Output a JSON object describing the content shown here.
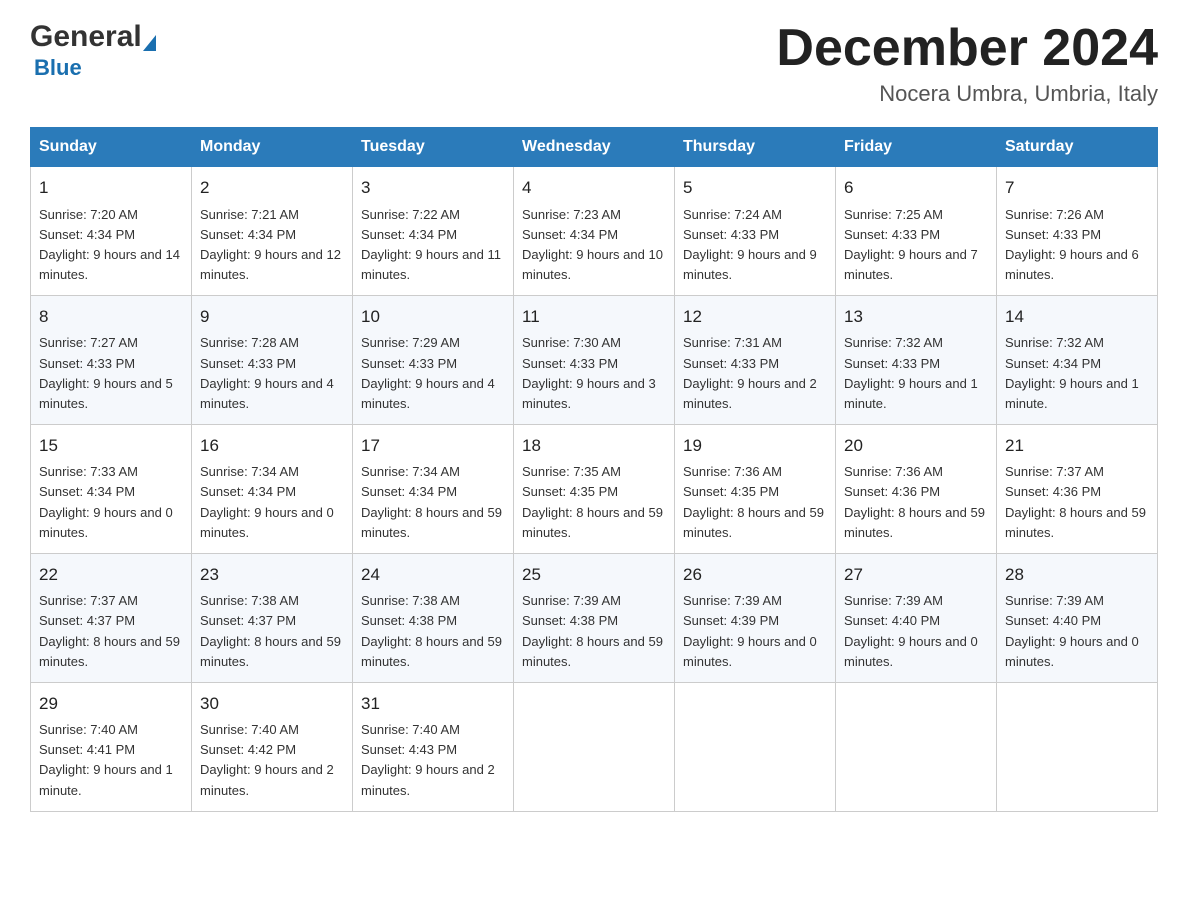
{
  "header": {
    "logo_general": "General",
    "logo_blue": "Blue",
    "month_title": "December 2024",
    "location": "Nocera Umbra, Umbria, Italy"
  },
  "days_of_week": [
    "Sunday",
    "Monday",
    "Tuesday",
    "Wednesday",
    "Thursday",
    "Friday",
    "Saturday"
  ],
  "weeks": [
    [
      {
        "day": 1,
        "sunrise": "7:20 AM",
        "sunset": "4:34 PM",
        "daylight": "9 hours and 14 minutes."
      },
      {
        "day": 2,
        "sunrise": "7:21 AM",
        "sunset": "4:34 PM",
        "daylight": "9 hours and 12 minutes."
      },
      {
        "day": 3,
        "sunrise": "7:22 AM",
        "sunset": "4:34 PM",
        "daylight": "9 hours and 11 minutes."
      },
      {
        "day": 4,
        "sunrise": "7:23 AM",
        "sunset": "4:34 PM",
        "daylight": "9 hours and 10 minutes."
      },
      {
        "day": 5,
        "sunrise": "7:24 AM",
        "sunset": "4:33 PM",
        "daylight": "9 hours and 9 minutes."
      },
      {
        "day": 6,
        "sunrise": "7:25 AM",
        "sunset": "4:33 PM",
        "daylight": "9 hours and 7 minutes."
      },
      {
        "day": 7,
        "sunrise": "7:26 AM",
        "sunset": "4:33 PM",
        "daylight": "9 hours and 6 minutes."
      }
    ],
    [
      {
        "day": 8,
        "sunrise": "7:27 AM",
        "sunset": "4:33 PM",
        "daylight": "9 hours and 5 minutes."
      },
      {
        "day": 9,
        "sunrise": "7:28 AM",
        "sunset": "4:33 PM",
        "daylight": "9 hours and 4 minutes."
      },
      {
        "day": 10,
        "sunrise": "7:29 AM",
        "sunset": "4:33 PM",
        "daylight": "9 hours and 4 minutes."
      },
      {
        "day": 11,
        "sunrise": "7:30 AM",
        "sunset": "4:33 PM",
        "daylight": "9 hours and 3 minutes."
      },
      {
        "day": 12,
        "sunrise": "7:31 AM",
        "sunset": "4:33 PM",
        "daylight": "9 hours and 2 minutes."
      },
      {
        "day": 13,
        "sunrise": "7:32 AM",
        "sunset": "4:33 PM",
        "daylight": "9 hours and 1 minute."
      },
      {
        "day": 14,
        "sunrise": "7:32 AM",
        "sunset": "4:34 PM",
        "daylight": "9 hours and 1 minute."
      }
    ],
    [
      {
        "day": 15,
        "sunrise": "7:33 AM",
        "sunset": "4:34 PM",
        "daylight": "9 hours and 0 minutes."
      },
      {
        "day": 16,
        "sunrise": "7:34 AM",
        "sunset": "4:34 PM",
        "daylight": "9 hours and 0 minutes."
      },
      {
        "day": 17,
        "sunrise": "7:34 AM",
        "sunset": "4:34 PM",
        "daylight": "8 hours and 59 minutes."
      },
      {
        "day": 18,
        "sunrise": "7:35 AM",
        "sunset": "4:35 PM",
        "daylight": "8 hours and 59 minutes."
      },
      {
        "day": 19,
        "sunrise": "7:36 AM",
        "sunset": "4:35 PM",
        "daylight": "8 hours and 59 minutes."
      },
      {
        "day": 20,
        "sunrise": "7:36 AM",
        "sunset": "4:36 PM",
        "daylight": "8 hours and 59 minutes."
      },
      {
        "day": 21,
        "sunrise": "7:37 AM",
        "sunset": "4:36 PM",
        "daylight": "8 hours and 59 minutes."
      }
    ],
    [
      {
        "day": 22,
        "sunrise": "7:37 AM",
        "sunset": "4:37 PM",
        "daylight": "8 hours and 59 minutes."
      },
      {
        "day": 23,
        "sunrise": "7:38 AM",
        "sunset": "4:37 PM",
        "daylight": "8 hours and 59 minutes."
      },
      {
        "day": 24,
        "sunrise": "7:38 AM",
        "sunset": "4:38 PM",
        "daylight": "8 hours and 59 minutes."
      },
      {
        "day": 25,
        "sunrise": "7:39 AM",
        "sunset": "4:38 PM",
        "daylight": "8 hours and 59 minutes."
      },
      {
        "day": 26,
        "sunrise": "7:39 AM",
        "sunset": "4:39 PM",
        "daylight": "9 hours and 0 minutes."
      },
      {
        "day": 27,
        "sunrise": "7:39 AM",
        "sunset": "4:40 PM",
        "daylight": "9 hours and 0 minutes."
      },
      {
        "day": 28,
        "sunrise": "7:39 AM",
        "sunset": "4:40 PM",
        "daylight": "9 hours and 0 minutes."
      }
    ],
    [
      {
        "day": 29,
        "sunrise": "7:40 AM",
        "sunset": "4:41 PM",
        "daylight": "9 hours and 1 minute."
      },
      {
        "day": 30,
        "sunrise": "7:40 AM",
        "sunset": "4:42 PM",
        "daylight": "9 hours and 2 minutes."
      },
      {
        "day": 31,
        "sunrise": "7:40 AM",
        "sunset": "4:43 PM",
        "daylight": "9 hours and 2 minutes."
      },
      null,
      null,
      null,
      null
    ]
  ],
  "labels": {
    "sunrise": "Sunrise:",
    "sunset": "Sunset:",
    "daylight": "Daylight:"
  }
}
